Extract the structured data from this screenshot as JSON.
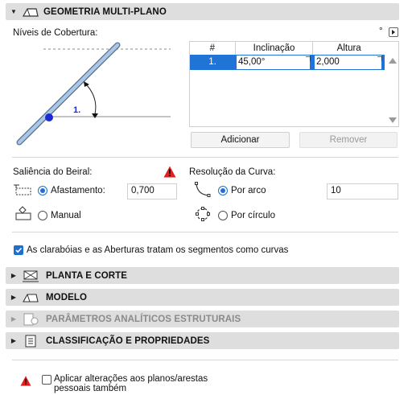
{
  "sections": {
    "geometry_title": "GEOMETRIA MULTI-PLANO",
    "plan_title": "PLANTA E CORTE",
    "model_title": "MODELO",
    "analytic_title": "PARÂMETROS ANALÍTICOS ESTRUTURAIS",
    "classification_title": "CLASSIFICAÇÃO E PROPRIEDADES"
  },
  "levels": {
    "label": "Níveis de Cobertura:",
    "degree_symbol": "°",
    "diagram_level_label": "1.",
    "table": {
      "headers": [
        "#",
        "Inclinação",
        "Altura"
      ],
      "rows": [
        {
          "num": "1.",
          "inclination": "45,00°",
          "height": "2,000"
        }
      ]
    },
    "add_button": "Adicionar",
    "remove_button": "Remover"
  },
  "overhang": {
    "label": "Saliência do Beiral:",
    "offset_label": "Afastamento:",
    "offset_value": "0,700",
    "manual_label": "Manual",
    "offset_selected": true
  },
  "curve": {
    "label": "Resolução da Curva:",
    "by_arc_label": "Por arco",
    "by_arc_value": "10",
    "by_circle_label": "Por círculo",
    "by_arc_selected": true
  },
  "skylights_checkbox": {
    "label": "As clarabóias e as Aberturas tratam os segmentos como curvas",
    "checked": true
  },
  "apply_checkbox": {
    "line1": "Aplicar alterações aos planos/arestas",
    "line2": "pessoais também",
    "checked": false
  },
  "colors": {
    "accent": "#1f6fd1",
    "selected_row": "#1f74d6",
    "roof_line": "#a9c7e8",
    "warning": "#e02020"
  }
}
